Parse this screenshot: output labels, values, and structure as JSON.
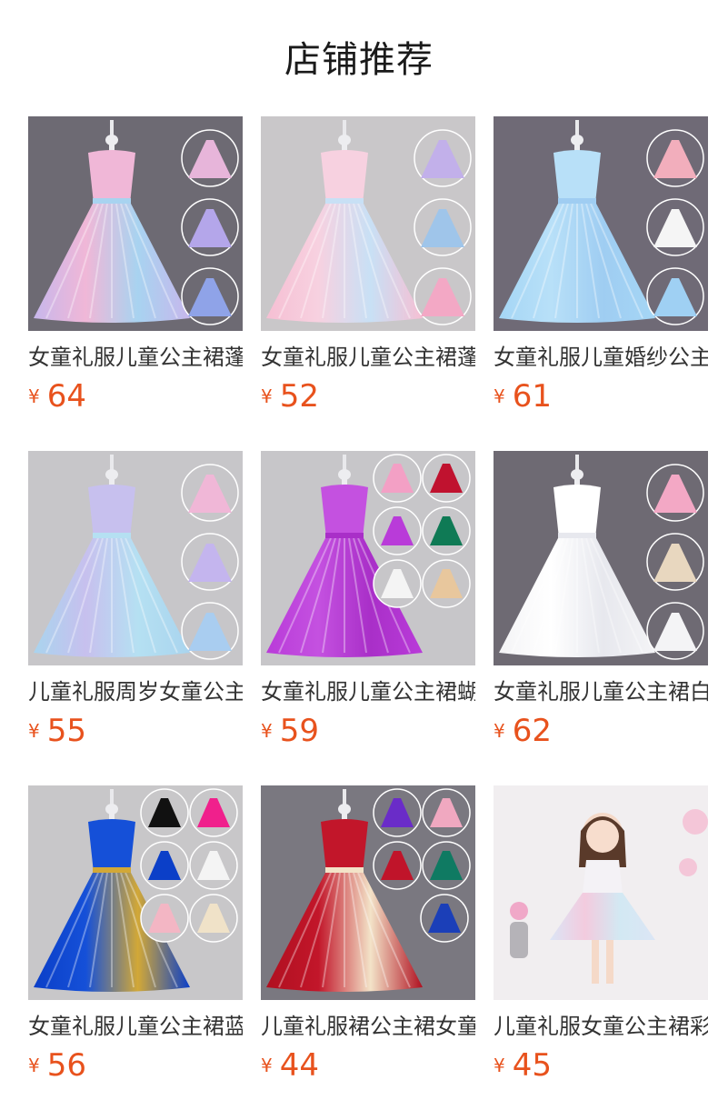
{
  "header": {
    "title": "店铺推荐"
  },
  "currency_symbol": "¥",
  "products": [
    {
      "name": "女童礼服儿童公主裙蓬蓬纱",
      "price": "64",
      "icon": "rainbow-gown-image",
      "bg": "#6d6a73",
      "colors": [
        "#c7b7ec",
        "#f0b7d7",
        "#a8d3f0"
      ],
      "swatches": [
        "#e7b5da",
        "#b4a6ea",
        "#8fa3e8"
      ]
    },
    {
      "name": "女童礼服儿童公主裙蓬蓬纱",
      "price": "52",
      "icon": "pink-gown-image",
      "bg": "#c9c7c9",
      "colors": [
        "#f6bfd3",
        "#f7d1e0",
        "#c8e0f5"
      ],
      "swatches": [
        "#c2b0ea",
        "#9fc5ea",
        "#f3a8c5"
      ]
    },
    {
      "name": "女童礼服儿童婚纱公主裙",
      "price": "61",
      "icon": "blue-gown-image",
      "bg": "#6f6a76",
      "colors": [
        "#a5d6f5",
        "#b8e0f8",
        "#9fcdf2"
      ],
      "swatches": [
        "#f2aebc",
        "#f5f5f5",
        "#9fd0f3"
      ]
    },
    {
      "name": "儿童礼服周岁女童公主裙",
      "price": "55",
      "icon": "pastel-gown-image",
      "bg": "#c7c6c9",
      "colors": [
        "#a9d4ee",
        "#c7c0ee",
        "#b5e0f2"
      ],
      "swatches": [
        "#f0b7d7",
        "#c4b5ee",
        "#a9cdf0"
      ]
    },
    {
      "name": "女童礼服儿童公主裙蝴蝶结",
      "price": "59",
      "icon": "purple-gown-image",
      "bg": "#c7c6c9",
      "colors": [
        "#b93bd9",
        "#c451e0",
        "#a92fc8"
      ],
      "swatches": [
        "#f3a0c5",
        "#c0122f",
        "#b93bd9",
        "#0f7a55",
        "#f4f4f4",
        "#e8c79d"
      ]
    },
    {
      "name": "女童礼服儿童公主裙白色",
      "price": "62",
      "icon": "white-gown-image",
      "bg": "#6e6a73",
      "colors": [
        "#f4f4f6",
        "#ffffff",
        "#e7e8ee"
      ],
      "swatches": [
        "#f3a8c5",
        "#e8d7bf",
        "#f4f4f6"
      ]
    },
    {
      "name": "女童礼服儿童公主裙蓝色",
      "price": "56",
      "icon": "royal-blue-gown-image",
      "bg": "#c8c7c9",
      "colors": [
        "#0b3fc8",
        "#1550d8",
        "#d2a837"
      ],
      "swatches": [
        "#111111",
        "#f0208c",
        "#0b3fc8",
        "#f4f4f4",
        "#f3b6c4",
        "#f0e2c8"
      ]
    },
    {
      "name": "儿童礼服裙公主裙女童",
      "price": "44",
      "icon": "red-gown-image",
      "bg": "#7a7880",
      "colors": [
        "#b01020",
        "#c2162a",
        "#f3e3c8"
      ],
      "swatches": [
        "#6a2cc8",
        "#f0a8c0",
        "#c0142a",
        "#0f7a62",
        "#1b3fb8"
      ]
    },
    {
      "name": "儿童礼服女童公主裙彩虹",
      "price": "45",
      "icon": "model-photo-image",
      "bg": "#f1eef0",
      "colors": [
        "#d9e4f6",
        "#f3c7dc",
        "#cfe8f3"
      ],
      "swatches": []
    }
  ]
}
